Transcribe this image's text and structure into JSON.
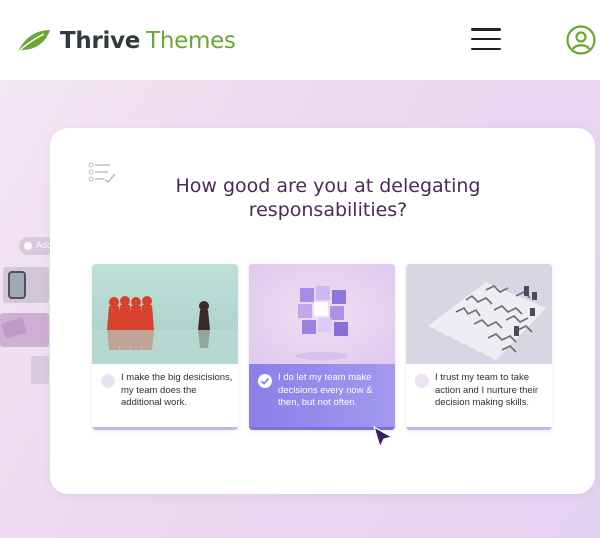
{
  "header": {
    "brand_part1": "Thrive",
    "brand_part2": "Themes",
    "brand_color": "#6aa833",
    "menu_icon": "hamburger-menu-icon",
    "account_icon": "user-circle-icon"
  },
  "hero": {
    "gradient_colors": [
      "#f4e6f3",
      "#e4d2f1"
    ],
    "side_fragment_label": "Add"
  },
  "quiz": {
    "question": "How good are you at delegating responsabilities?",
    "accent_color": "#8f84ea",
    "options": [
      {
        "text": "I make the big desicisions, my team does the additional work.",
        "image": "red-game-pieces-photo",
        "selected": false
      },
      {
        "text": "I do let my team make decisions every now & then, but not often.",
        "image": "abstract-cube-photo",
        "selected": true
      },
      {
        "text": "I trust my team to take action and I nurture their decision making skills.",
        "image": "maze-puzzle-photo",
        "selected": false
      }
    ]
  }
}
